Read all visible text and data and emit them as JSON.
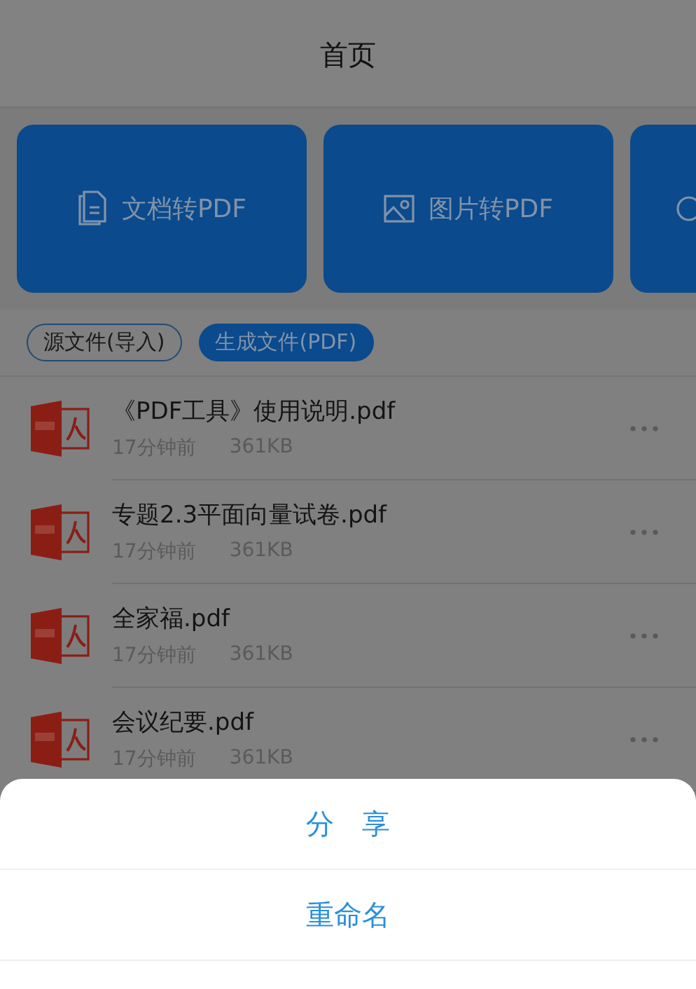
{
  "header": {
    "title": "首页"
  },
  "tools": [
    {
      "label": "文档转PDF",
      "kind": "document"
    },
    {
      "label": "图片转PDF",
      "kind": "image"
    },
    {
      "kind": "partial"
    }
  ],
  "filters": [
    {
      "label": "源文件(导入)",
      "selected": false
    },
    {
      "label": "生成文件(PDF)",
      "selected": true
    }
  ],
  "files": [
    {
      "name": "《PDF工具》使用说明.pdf",
      "time": "17分钟前",
      "size": "361KB"
    },
    {
      "name": "专题2.3平面向量试卷.pdf",
      "time": "17分钟前",
      "size": "361KB"
    },
    {
      "name": "全家福.pdf",
      "time": "17分钟前",
      "size": "361KB"
    },
    {
      "name": "会议纪要.pdf",
      "time": "17分钟前",
      "size": "361KB"
    }
  ],
  "action_sheet": {
    "items": [
      "分　享",
      "重命名"
    ]
  }
}
